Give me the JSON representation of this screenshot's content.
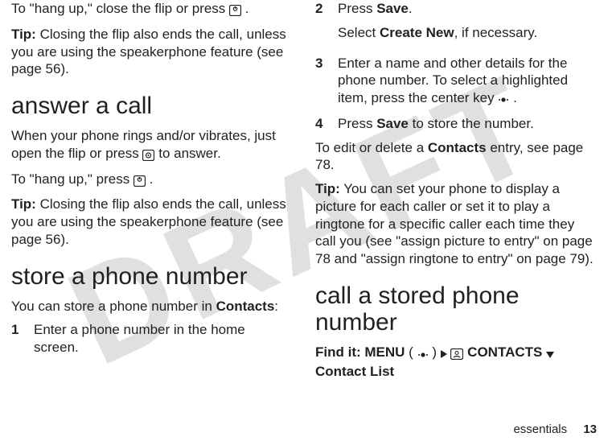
{
  "watermark": "DRAFT",
  "left": {
    "p1a": "To \"hang up,\" close the flip or press ",
    "p1b": ".",
    "tip_label": "Tip:",
    "tip1": " Closing the flip also ends the call, unless you are using the speakerphone feature (see page 56).",
    "h1": "answer a call",
    "p2a": "When your phone rings and/or vibrates, just open the flip or press ",
    "p2b": " to answer.",
    "p3a": "To \"hang up,\" press ",
    "p3b": ".",
    "tip2": " Closing the flip also ends the call, unless you are using the speakerphone feature (see page 56).",
    "h2": "store a phone number",
    "p4a": "You can store a phone number in ",
    "p4b": "Contacts",
    "p4c": ":",
    "step1_num": "1",
    "step1": "Enter a phone number in the home screen."
  },
  "right": {
    "step2_num": "2",
    "step2a": "Press ",
    "step2b": "Save",
    "step2c": ".",
    "step2d_a": "Select ",
    "step2d_b": "Create New",
    "step2d_c": ", if necessary.",
    "step3_num": "3",
    "step3a": "Enter a name and other details for the phone number. To select a highlighted item, press the center key ",
    "step3b": ".",
    "step4_num": "4",
    "step4a": "Press ",
    "step4b": "Save",
    "step4c": " to store the number.",
    "p5a": "To edit or delete a ",
    "p5b": "Contacts",
    "p5c": " entry, see page 78.",
    "tip_label": "Tip:",
    "tip3": " You can set your phone to display a picture for each caller or set it to play a ringtone for a specific caller each time they call you (see \"assign picture to entry\" on page 78 and \"assign ringtone to entry\" on page 79).",
    "h3": "call a stored phone number",
    "findit_label": "Find it: ",
    "findit_a": "MENU",
    "findit_b": " (",
    "findit_c": ") ",
    "findit_d": " CONTACTS ",
    "findit_e": " Contact List"
  },
  "footer": {
    "label": "essentials",
    "page": "13"
  }
}
